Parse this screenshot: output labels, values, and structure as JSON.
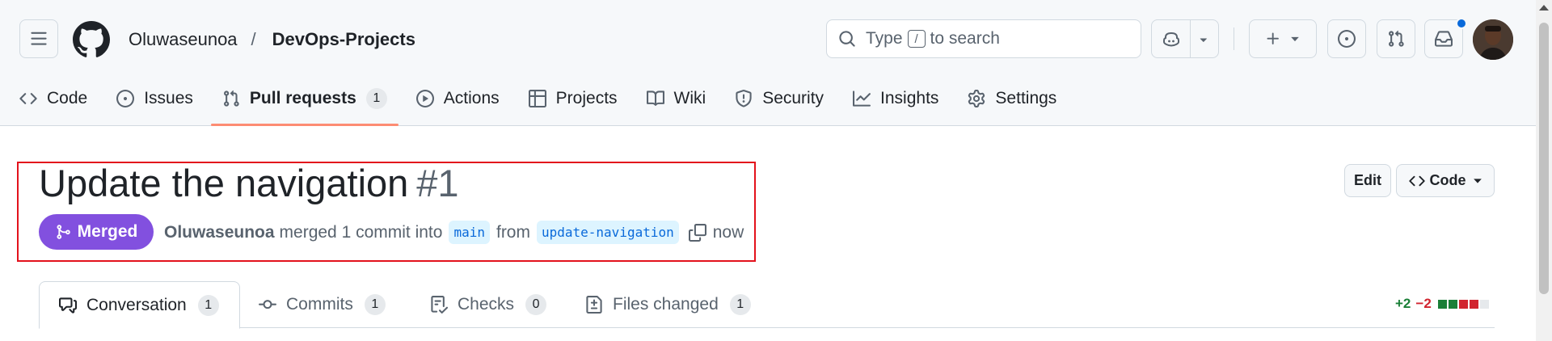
{
  "header": {
    "owner": "Oluwaseunoa",
    "separator": "/",
    "repo": "DevOps-Projects",
    "search": {
      "prefix": "Type",
      "key": "/",
      "suffix": "to search"
    },
    "notification_dot_color": "#0969da"
  },
  "repo_tabs": [
    {
      "label": "Code",
      "icon": "code-icon"
    },
    {
      "label": "Issues",
      "icon": "issue-opened-icon"
    },
    {
      "label": "Pull requests",
      "icon": "git-pull-request-icon",
      "count": "1",
      "active": true
    },
    {
      "label": "Actions",
      "icon": "play-icon"
    },
    {
      "label": "Projects",
      "icon": "table-icon"
    },
    {
      "label": "Wiki",
      "icon": "book-icon"
    },
    {
      "label": "Security",
      "icon": "shield-icon"
    },
    {
      "label": "Insights",
      "icon": "graph-icon"
    },
    {
      "label": "Settings",
      "icon": "gear-icon"
    }
  ],
  "pr": {
    "title": "Update the navigation",
    "number": "#1",
    "status": "Merged",
    "status_color": "#8250df",
    "author": "Oluwaseunoa",
    "action_text": "merged 1 commit into",
    "base_branch": "main",
    "from_text": "from",
    "head_branch": "update-navigation",
    "time": "now",
    "edit_label": "Edit",
    "code_label": "Code"
  },
  "pr_tabs": {
    "conversation": {
      "label": "Conversation",
      "count": "1"
    },
    "commits": {
      "label": "Commits",
      "count": "1"
    },
    "checks": {
      "label": "Checks",
      "count": "0"
    },
    "files": {
      "label": "Files changed",
      "count": "1"
    }
  },
  "diffstat": {
    "additions": "+2",
    "deletions": "−2",
    "blocks": [
      "#1a7f37",
      "#1a7f37",
      "#d1242f",
      "#d1242f",
      "#e6e9ec"
    ]
  }
}
